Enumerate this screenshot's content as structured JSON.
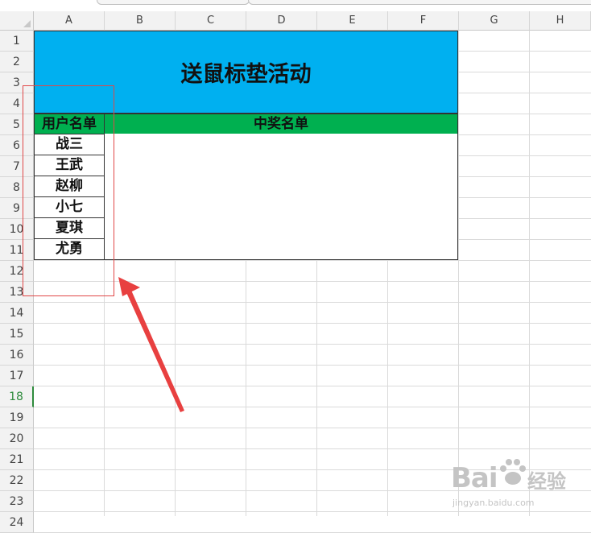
{
  "columns": [
    "A",
    "B",
    "C",
    "D",
    "E",
    "F",
    "G",
    "H"
  ],
  "rows": [
    "1",
    "2",
    "3",
    "4",
    "5",
    "6",
    "7",
    "8",
    "9",
    "10",
    "11",
    "12",
    "13",
    "14",
    "15",
    "16",
    "17",
    "18",
    "19",
    "20",
    "21",
    "22",
    "23",
    "24"
  ],
  "active_row": "18",
  "sheet": {
    "title": "送鼠标垫活动",
    "user_header": "用户名单",
    "winner_header": "中奖名单",
    "users": [
      "战三",
      "王武",
      "赵柳",
      "小七",
      "夏琪",
      "尤勇"
    ]
  },
  "colors": {
    "title_fill": "#00b0f0",
    "header_fill": "#00b050",
    "annotation": "#e04848"
  },
  "watermark": {
    "logo": "Bai",
    "logo_suffix": "经验",
    "url": "jingyan.baidu.com"
  }
}
